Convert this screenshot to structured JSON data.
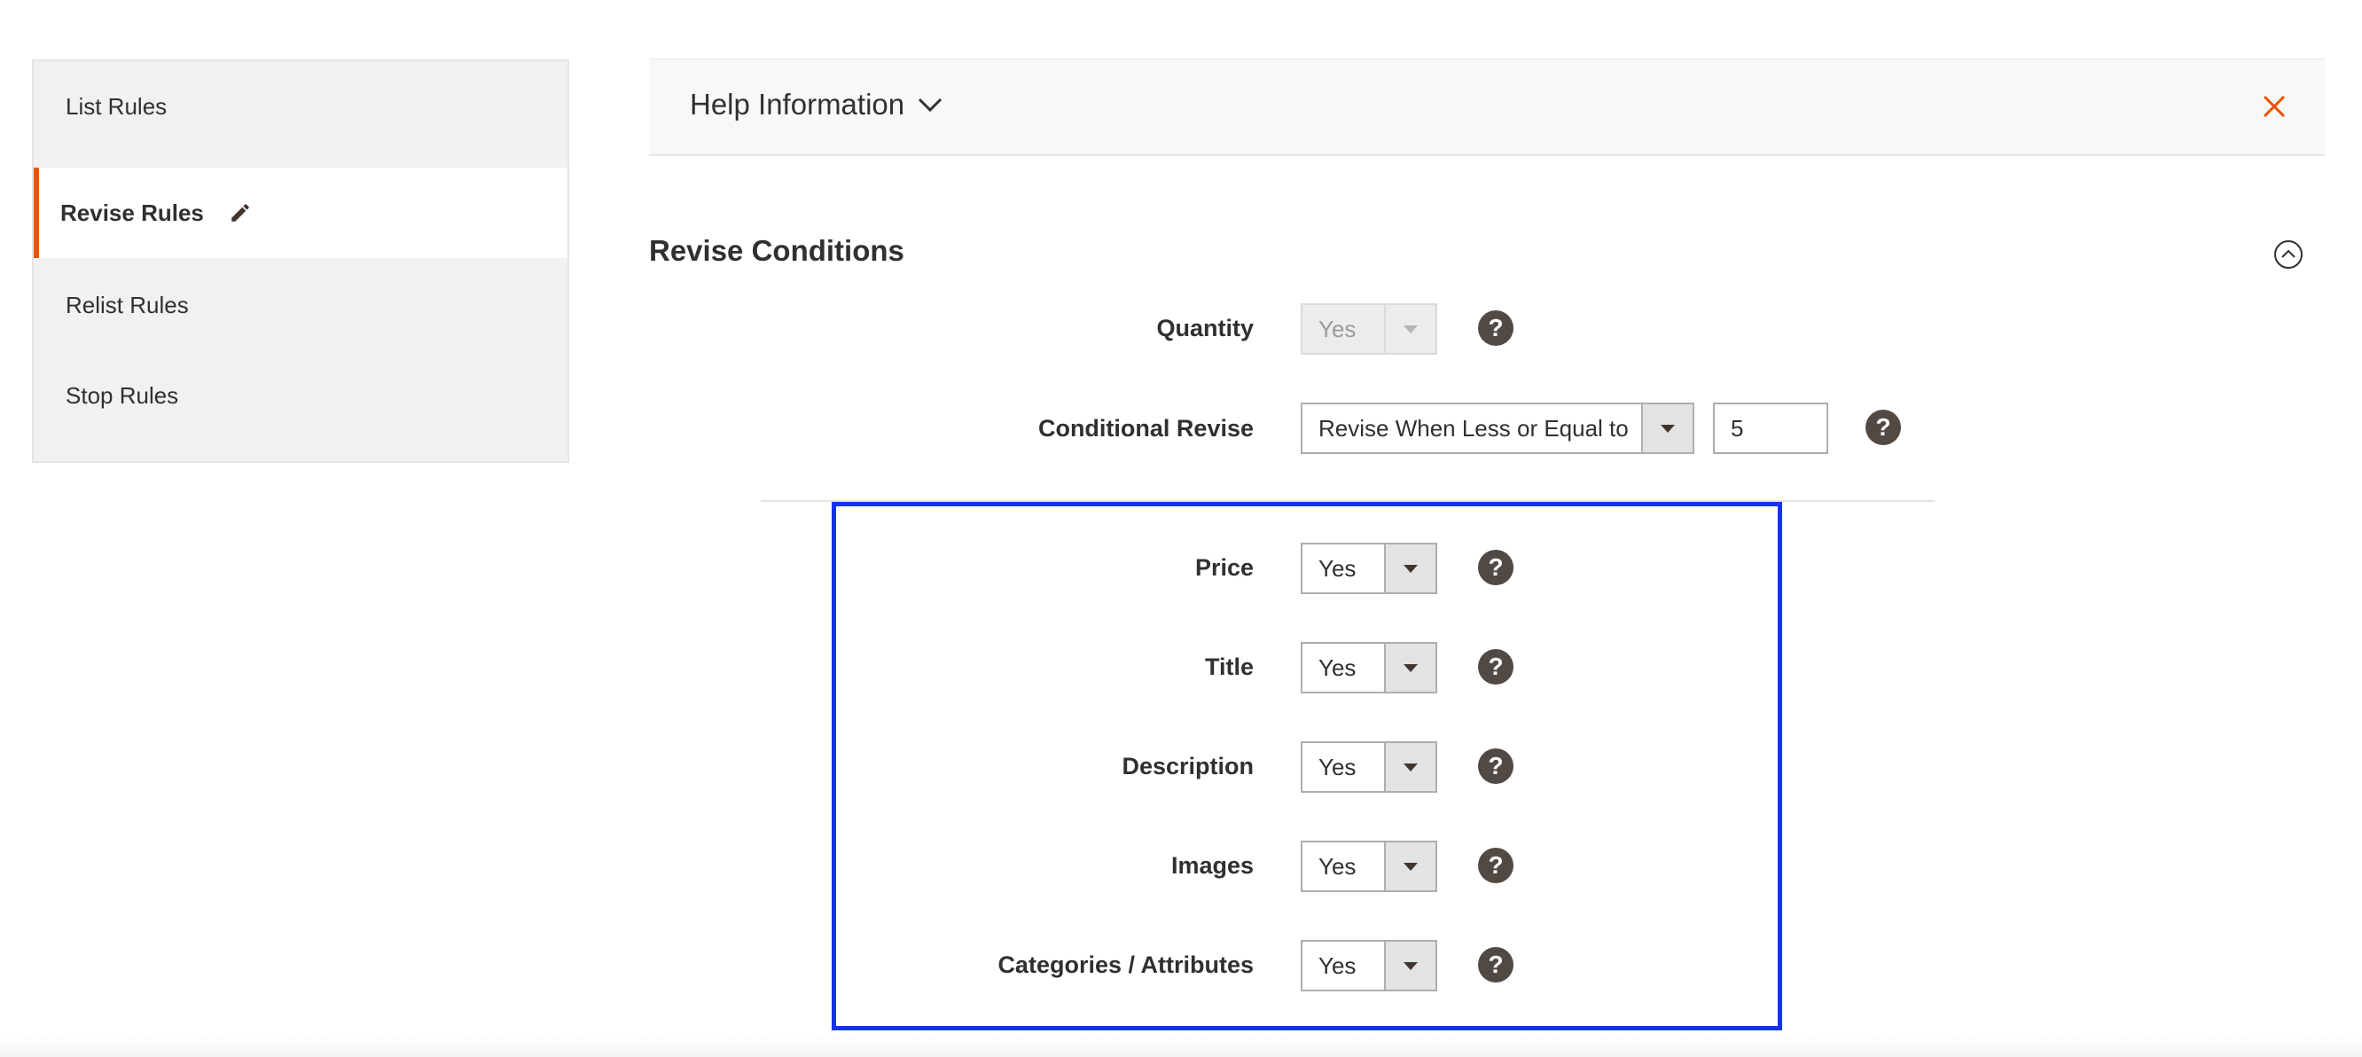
{
  "sidebar": {
    "items": [
      {
        "label": "List Rules"
      },
      {
        "label": "Revise Rules",
        "active": true
      },
      {
        "label": "Relist Rules"
      },
      {
        "label": "Stop Rules"
      }
    ],
    "active_indicator_color": "#eb5202"
  },
  "help": {
    "title": "Help Information",
    "close_color": "#eb5202"
  },
  "section": {
    "title": "Revise Conditions"
  },
  "form": {
    "quantity": {
      "label": "Quantity",
      "value": "Yes",
      "disabled": true
    },
    "conditional_revise": {
      "label": "Conditional Revise",
      "value": "Revise When Less or Equal to",
      "qty_value": "5"
    },
    "price": {
      "label": "Price",
      "value": "Yes"
    },
    "title": {
      "label": "Title",
      "value": "Yes"
    },
    "description": {
      "label": "Description",
      "value": "Yes"
    },
    "images": {
      "label": "Images",
      "value": "Yes"
    },
    "categories": {
      "label": "Categories / Attributes",
      "value": "Yes"
    }
  },
  "help_icon_glyph": "?",
  "highlight_color": "#1433e6"
}
